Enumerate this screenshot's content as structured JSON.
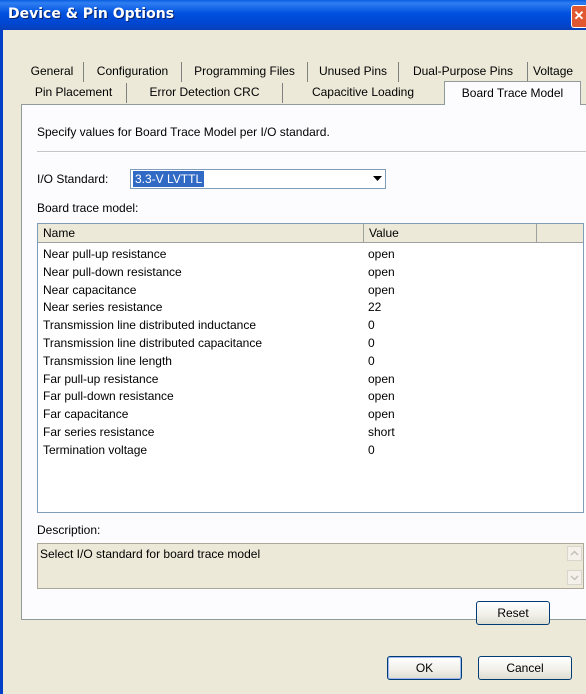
{
  "window": {
    "title": "Device & Pin Options",
    "close_glyph": "✕"
  },
  "tabs": {
    "row1": [
      "General",
      "Configuration",
      "Programming Files",
      "Unused Pins",
      "Dual-Purpose Pins",
      "Voltage"
    ],
    "row2": [
      "Pin Placement",
      "Error Detection CRC",
      "Capacitive Loading",
      "Board Trace Model"
    ],
    "active": "Board Trace Model"
  },
  "panel": {
    "instruction": "Specify values for Board Trace Model per I/O standard.",
    "io_standard_label": "I/O Standard:",
    "io_standard_value": "3.3-V LVTTL",
    "board_trace_label": "Board trace model:",
    "columns": [
      "Name",
      "Value"
    ],
    "rows": [
      {
        "name": "Near pull-up resistance",
        "value": "open"
      },
      {
        "name": "Near pull-down resistance",
        "value": "open"
      },
      {
        "name": "Near capacitance",
        "value": "open"
      },
      {
        "name": "Near series resistance",
        "value": "22"
      },
      {
        "name": "Transmission line distributed inductance",
        "value": "0"
      },
      {
        "name": "Transmission line distributed capacitance",
        "value": "0"
      },
      {
        "name": "Transmission line length",
        "value": "0"
      },
      {
        "name": "Far pull-up resistance",
        "value": "open"
      },
      {
        "name": "Far pull-down resistance",
        "value": "open"
      },
      {
        "name": "Far capacitance",
        "value": "open"
      },
      {
        "name": "Far series resistance",
        "value": "short"
      },
      {
        "name": "Termination voltage",
        "value": "0"
      }
    ],
    "description_label": "Description:",
    "description_text": "Select I/O standard for board trace model",
    "reset_label": "Reset"
  },
  "buttons": {
    "ok": "OK",
    "cancel": "Cancel"
  },
  "icons": {
    "dropdown": "chevron-down-icon",
    "scroll_up": "scroll-up-icon",
    "scroll_down": "scroll-down-icon",
    "close": "close-icon"
  }
}
